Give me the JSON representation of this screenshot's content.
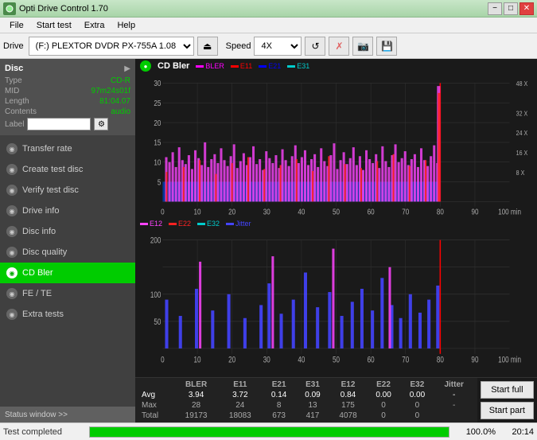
{
  "app": {
    "title": "Opti Drive Control 1.70",
    "icon": "disc-icon"
  },
  "titlebar": {
    "minimize_label": "−",
    "maximize_label": "□",
    "close_label": "✕"
  },
  "menubar": {
    "items": [
      "File",
      "Start test",
      "Extra",
      "Help"
    ]
  },
  "toolbar": {
    "drive_label": "Drive",
    "drive_value": "(F:)  PLEXTOR DVDR  PX-755A 1.08",
    "speed_label": "Speed",
    "speed_value": "4X",
    "eject_icon": "eject-icon",
    "refresh_icon": "refresh-icon",
    "eraser_icon": "eraser-icon",
    "camera_icon": "camera-icon",
    "save_icon": "save-icon"
  },
  "sidebar": {
    "disc_title": "Disc",
    "disc_info": {
      "type_label": "Type",
      "type_value": "CD-R",
      "mid_label": "MID",
      "mid_value": "97m24s01f",
      "length_label": "Length",
      "length_value": "81:04.07",
      "contents_label": "Contents",
      "contents_value": "audio",
      "label_label": "Label",
      "label_value": ""
    },
    "nav_items": [
      {
        "id": "transfer-rate",
        "label": "Transfer rate",
        "active": false
      },
      {
        "id": "create-test-disc",
        "label": "Create test disc",
        "active": false
      },
      {
        "id": "verify-test-disc",
        "label": "Verify test disc",
        "active": false
      },
      {
        "id": "drive-info",
        "label": "Drive info",
        "active": false
      },
      {
        "id": "disc-info",
        "label": "Disc info",
        "active": false
      },
      {
        "id": "disc-quality",
        "label": "Disc quality",
        "active": false
      },
      {
        "id": "cd-bler",
        "label": "CD Bler",
        "active": true
      },
      {
        "id": "fe-te",
        "label": "FE / TE",
        "active": false
      },
      {
        "id": "extra-tests",
        "label": "Extra tests",
        "active": false
      }
    ],
    "status_window_label": "Status window >>"
  },
  "chart1": {
    "title": "CD Bler",
    "legend": [
      {
        "label": "BLER",
        "color": "#ff00ff"
      },
      {
        "label": "E11",
        "color": "#ff0000"
      },
      {
        "label": "E21",
        "color": "#0000ff"
      },
      {
        "label": "E31",
        "color": "#00ffff"
      }
    ],
    "y_max": 30,
    "y_axis_right": [
      "48 X",
      "32 X",
      "24 X",
      "16 X",
      "8 X"
    ],
    "x_labels": [
      "0",
      "10",
      "20",
      "30",
      "40",
      "50",
      "60",
      "70",
      "80",
      "90",
      "100 min"
    ]
  },
  "chart2": {
    "legend": [
      {
        "label": "E12",
        "color": "#ff00ff"
      },
      {
        "label": "E22",
        "color": "#ff0000"
      },
      {
        "label": "E32",
        "color": "#00ffff"
      },
      {
        "label": "Jitter",
        "color": "#0000ff"
      }
    ],
    "y_max": 200,
    "x_labels": [
      "0",
      "10",
      "20",
      "30",
      "40",
      "50",
      "60",
      "70",
      "80",
      "90",
      "100 min"
    ]
  },
  "data_table": {
    "headers": [
      "",
      "BLER",
      "E11",
      "E21",
      "E31",
      "E12",
      "E22",
      "E32",
      "Jitter"
    ],
    "rows": [
      {
        "label": "Avg",
        "values": [
          "3.94",
          "3.72",
          "0.14",
          "0.09",
          "0.84",
          "0.00",
          "0.00",
          "-"
        ]
      },
      {
        "label": "Max",
        "values": [
          "28",
          "24",
          "8",
          "13",
          "175",
          "0",
          "0",
          "-"
        ]
      },
      {
        "label": "Total",
        "values": [
          "19173",
          "18083",
          "673",
          "417",
          "4078",
          "0",
          "0",
          ""
        ]
      }
    ]
  },
  "buttons": {
    "start_full": "Start full",
    "start_part": "Start part"
  },
  "bottom_bar": {
    "status": "Test completed",
    "progress": 100,
    "progress_text": "100.0%",
    "time": "20:14"
  }
}
